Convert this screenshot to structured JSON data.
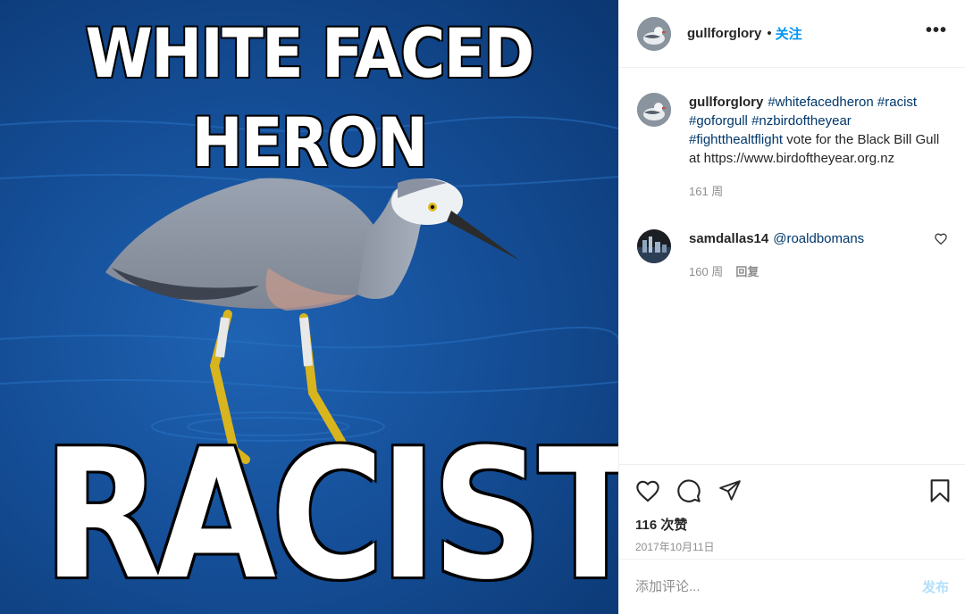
{
  "media": {
    "top_text": "WHITE FACED HERON",
    "bottom_text": "RACIST"
  },
  "header": {
    "username": "gullforglory",
    "separator": "•",
    "follow_label": "关注",
    "more_label": "•••"
  },
  "caption": {
    "username": "gullforglory",
    "hashtags": [
      "#whitefacedheron",
      "#racist",
      "#goforgull",
      "#nzbirdoftheyear",
      "#fightthealtflight"
    ],
    "text": "vote for the Black Bill Gull at https://www.birdoftheyear.org.nz",
    "time": "161 周"
  },
  "comments": [
    {
      "username": "samdallas14",
      "mention": "@roaldbomans",
      "time": "160 周",
      "reply_label": "回复"
    }
  ],
  "actions": {
    "icons": [
      "heart-icon",
      "comment-icon",
      "share-icon",
      "bookmark-icon"
    ],
    "likes": "116 次赞",
    "date": "2017年10月11日"
  },
  "add_comment": {
    "placeholder": "添加评论...",
    "post_label": "发布"
  },
  "colors": {
    "link": "#00376b",
    "follow": "#0095f6",
    "post_disabled": "#b2dffc",
    "muted": "#8e8e8e"
  }
}
